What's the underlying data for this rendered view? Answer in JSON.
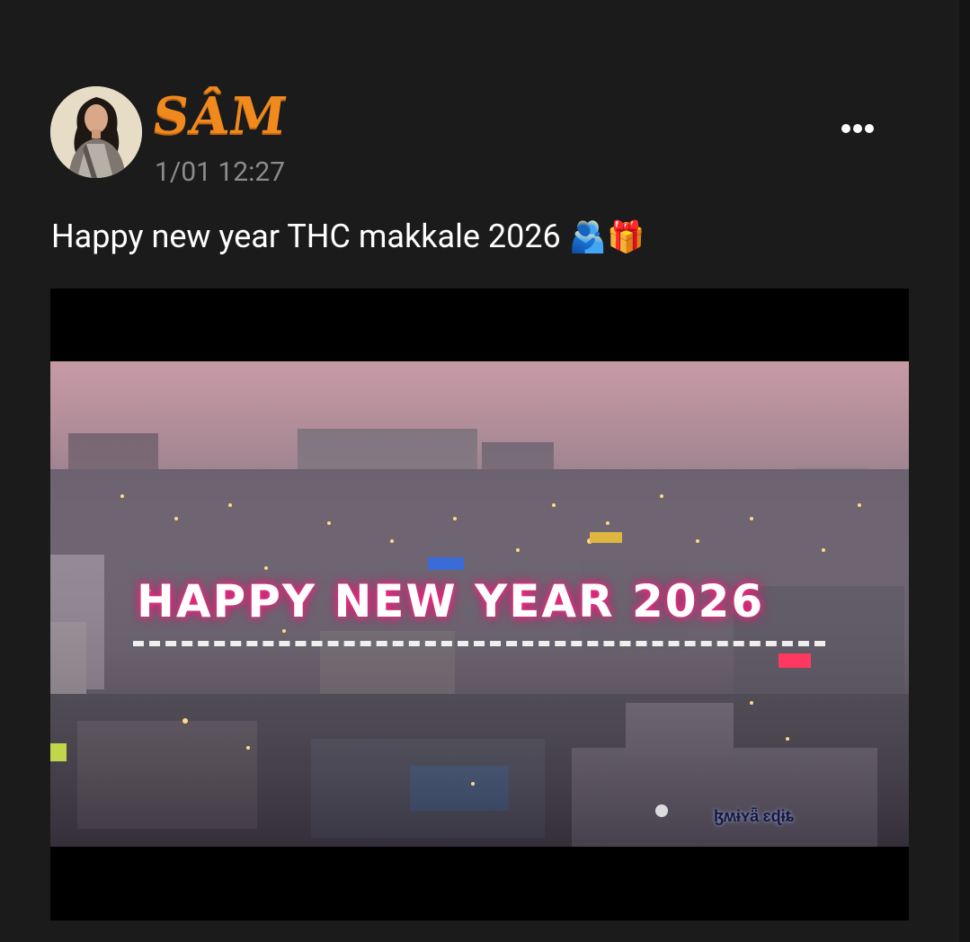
{
  "post": {
    "author": "SÂM",
    "timestamp": "1/01 12:27",
    "caption": "Happy new year THC makkale 2026",
    "caption_emojis": "🫂🎁"
  },
  "icons": {
    "avatar": "profile-photo",
    "more": "more-horizontal-icon"
  },
  "media": {
    "overlay_text": "HAPPY NEW YEAR 2026",
    "watermark": "ɮʍɨʏǟ ɛɖɨȶ"
  },
  "colors": {
    "background": "#1b1b1b",
    "username": "#f08a1e",
    "timestamp": "#8c8c8c",
    "caption": "#ffffff"
  }
}
